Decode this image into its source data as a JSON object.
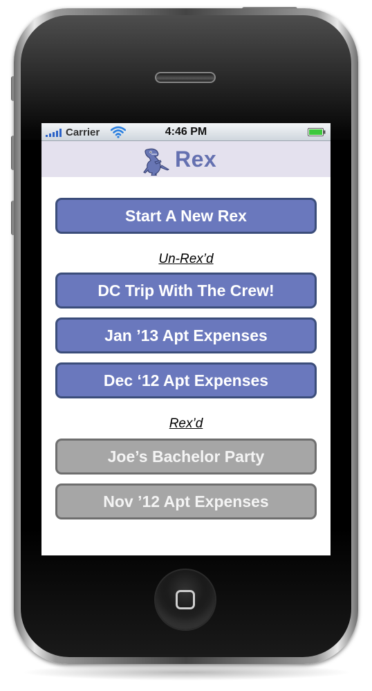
{
  "status_bar": {
    "carrier": "Carrier",
    "time": "4:46 PM",
    "signal_icon": "signal-bars-icon",
    "wifi_icon": "wifi-icon",
    "battery_icon": "battery-icon"
  },
  "app": {
    "title": "Rex",
    "logo_icon": "dinosaur-icon"
  },
  "main": {
    "new_button": "Start A New Rex",
    "unrexd_heading": "Un-Rex’d",
    "unrexd_items": [
      {
        "label": "DC Trip With The Crew!"
      },
      {
        "label": "Jan ’13 Apt Expenses"
      },
      {
        "label": "Dec ‘12 Apt Expenses"
      }
    ],
    "rexd_heading": "Rex’d",
    "rexd_items": [
      {
        "label": "Joe’s Bachelor Party"
      },
      {
        "label": "Nov ’12 Apt Expenses"
      }
    ]
  },
  "colors": {
    "header_bg": "#e4e1ee",
    "title_color": "#6470b0",
    "active_button": "#6a78bd",
    "active_border": "#3b4d7a",
    "done_button": "#a6a6a6",
    "done_border": "#6e6e6e",
    "battery_green": "#3cc83c"
  }
}
